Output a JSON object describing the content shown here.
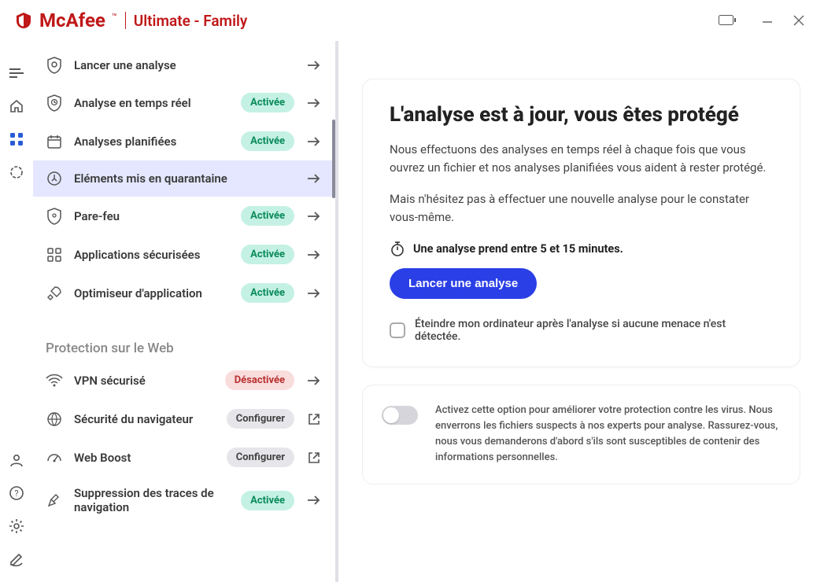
{
  "brand": {
    "name": "McAfee",
    "product": "Ultimate - Family"
  },
  "rail": {
    "items": [
      "menu",
      "home",
      "grid",
      "circle"
    ],
    "bottom": [
      "user",
      "help",
      "gear",
      "edit"
    ]
  },
  "sidebar": {
    "items": [
      {
        "label": "Lancer une analyse",
        "badge": "",
        "badge_type": "",
        "action": "arrow"
      },
      {
        "label": "Analyse en temps réel",
        "badge": "Activée",
        "badge_type": "on",
        "action": "arrow"
      },
      {
        "label": "Analyses planifiées",
        "badge": "Activée",
        "badge_type": "on",
        "action": "arrow"
      },
      {
        "label": "Eléments mis en quarantaine",
        "badge": "",
        "badge_type": "",
        "action": "arrow",
        "selected": true
      },
      {
        "label": "Pare-feu",
        "badge": "Activée",
        "badge_type": "on",
        "action": "arrow"
      },
      {
        "label": "Applications sécurisées",
        "badge": "Activée",
        "badge_type": "on",
        "action": "arrow"
      },
      {
        "label": "Optimiseur d'application",
        "badge": "Activée",
        "badge_type": "on",
        "action": "arrow"
      }
    ],
    "section2_title": "Protection sur le Web",
    "items2": [
      {
        "label": "VPN sécurisé",
        "badge": "Désactivée",
        "badge_type": "off",
        "action": "arrow"
      },
      {
        "label": "Sécurité du navigateur",
        "badge": "Configurer",
        "badge_type": "cfg",
        "action": "external"
      },
      {
        "label": "Web Boost",
        "badge": "Configurer",
        "badge_type": "cfg",
        "action": "external"
      },
      {
        "label": "Suppression des traces de navigation",
        "badge": "Activée",
        "badge_type": "on",
        "action": "arrow"
      }
    ]
  },
  "main": {
    "title": "L'analyse est à jour, vous êtes protégé",
    "para1": "Nous effectuons des analyses en temps réel à chaque fois que vous ouvrez un fichier et nos analyses planifiées vous aident à rester protégé.",
    "para2": "Mais n'hésitez pas à effectuer une nouvelle analyse pour le constater vous-même.",
    "hint": "Une analyse prend entre 5 et 15 minutes.",
    "button": "Lancer une analyse",
    "checkbox_label": "Éteindre mon ordinateur après l'analyse si aucune menace n'est détectée.",
    "sub_text": "Activez cette option pour améliorer votre protection contre les virus. Nous enverrons les fichiers suspects à nos experts pour analyse. Rassurez-vous, nous vous demanderons d'abord s'ils sont susceptibles de contenir des informations personnelles."
  }
}
